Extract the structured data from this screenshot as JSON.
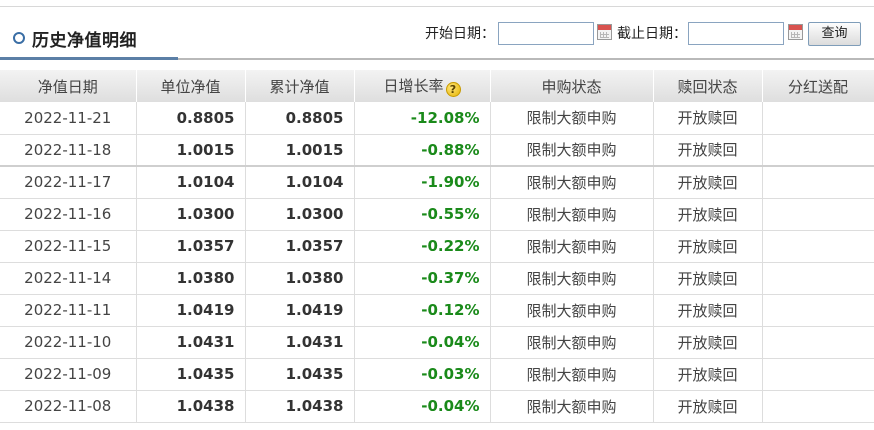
{
  "header": {
    "title": "历史净值明细",
    "start_label": "开始日期：",
    "end_label": "截止日期：",
    "start_value": "",
    "end_value": "",
    "query_label": "查询"
  },
  "table": {
    "columns": [
      "净值日期",
      "单位净值",
      "累计净值",
      "日增长率",
      "申购状态",
      "赎回状态",
      "分红送配"
    ],
    "help_icon": "question-mark-icon",
    "rows": [
      {
        "date": "2022-11-21",
        "unit": "0.8805",
        "cum": "0.8805",
        "chg": "-12.08%",
        "buy": "限制大额申购",
        "redeem": "开放赎回",
        "div": ""
      },
      {
        "date": "2022-11-18",
        "unit": "1.0015",
        "cum": "1.0015",
        "chg": "-0.88%",
        "buy": "限制大额申购",
        "redeem": "开放赎回",
        "div": ""
      },
      {
        "date": "2022-11-17",
        "unit": "1.0104",
        "cum": "1.0104",
        "chg": "-1.90%",
        "buy": "限制大额申购",
        "redeem": "开放赎回",
        "div": ""
      },
      {
        "date": "2022-11-16",
        "unit": "1.0300",
        "cum": "1.0300",
        "chg": "-0.55%",
        "buy": "限制大额申购",
        "redeem": "开放赎回",
        "div": ""
      },
      {
        "date": "2022-11-15",
        "unit": "1.0357",
        "cum": "1.0357",
        "chg": "-0.22%",
        "buy": "限制大额申购",
        "redeem": "开放赎回",
        "div": ""
      },
      {
        "date": "2022-11-14",
        "unit": "1.0380",
        "cum": "1.0380",
        "chg": "-0.37%",
        "buy": "限制大额申购",
        "redeem": "开放赎回",
        "div": ""
      },
      {
        "date": "2022-11-11",
        "unit": "1.0419",
        "cum": "1.0419",
        "chg": "-0.12%",
        "buy": "限制大额申购",
        "redeem": "开放赎回",
        "div": ""
      },
      {
        "date": "2022-11-10",
        "unit": "1.0431",
        "cum": "1.0431",
        "chg": "-0.04%",
        "buy": "限制大额申购",
        "redeem": "开放赎回",
        "div": ""
      },
      {
        "date": "2022-11-09",
        "unit": "1.0435",
        "cum": "1.0435",
        "chg": "-0.03%",
        "buy": "限制大额申购",
        "redeem": "开放赎回",
        "div": ""
      },
      {
        "date": "2022-11-08",
        "unit": "1.0438",
        "cum": "1.0438",
        "chg": "-0.04%",
        "buy": "限制大额申购",
        "redeem": "开放赎回",
        "div": ""
      }
    ]
  },
  "colors": {
    "negative": "#1a8a1a",
    "accent": "#3a6ea5"
  }
}
